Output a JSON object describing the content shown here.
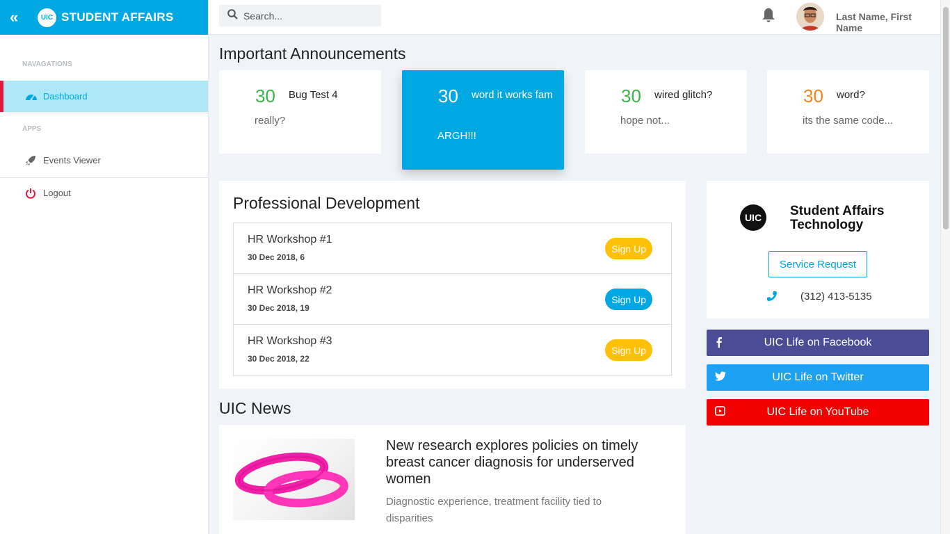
{
  "brand": {
    "collapse_icon": "double-chevron-left",
    "logo_text": "UIC",
    "name": "STUDENT AFFAIRS"
  },
  "sidebar": {
    "section_nav": "NAVAGATIONS",
    "section_apps": "APPS",
    "items": [
      {
        "label": "Dashboard",
        "icon": "speedometer-icon",
        "active": true
      },
      {
        "label": "Events Viewer",
        "icon": "rocket-icon",
        "active": false
      },
      {
        "label": "Logout",
        "icon": "power-icon",
        "active": false
      }
    ]
  },
  "header": {
    "search_placeholder": "Search...",
    "user_name": "Last Name, First Name"
  },
  "announcements": {
    "title": "Important Announcements",
    "cards": [
      {
        "number": "30",
        "title": "Bug Test 4",
        "desc": "really?",
        "number_color": "#3ab54a"
      },
      {
        "number": "30",
        "title": "word it works fam",
        "desc": "ARGH!!!",
        "number_color": "#ffffff"
      },
      {
        "number": "30",
        "title": "wired glitch?",
        "desc": "hope not...",
        "number_color": "#3ab54a"
      },
      {
        "number": "30",
        "title": "word?",
        "desc": "its the same code...",
        "number_color": "#f5841f"
      }
    ]
  },
  "professional_development": {
    "title": "Professional Development",
    "rows": [
      {
        "name": "HR Workshop #1",
        "date": "30 Dec 2018, 6",
        "button": "Sign Up",
        "button_color": "#ffc107"
      },
      {
        "name": "HR Workshop #2",
        "date": "30 Dec 2018, 19",
        "button": "Sign Up",
        "button_color": "#00a8e1"
      },
      {
        "name": "HR Workshop #3",
        "date": "30 Dec 2018, 22",
        "button": "Sign Up",
        "button_color": "#ffc107"
      }
    ]
  },
  "sat_card": {
    "logo_text": "UIC",
    "name_line1": "Student Affairs",
    "name_line2": "Technology",
    "service_button": "Service Request",
    "phone": "(312) 413-5135"
  },
  "social": [
    {
      "label": "UIC Life on Facebook",
      "icon": "facebook-icon",
      "color": "#4a4c96"
    },
    {
      "label": "UIC Life on Twitter",
      "icon": "twitter-icon",
      "color": "#1da1f2"
    },
    {
      "label": "UIC Life on YouTube",
      "icon": "youtube-icon",
      "color": "#f20000"
    }
  ],
  "news": {
    "title": "UIC News",
    "item_title": "New research explores policies on timely breast cancer diagnosis for underserved women",
    "item_desc": "Diagnostic experience, treatment facility tied to disparities"
  }
}
